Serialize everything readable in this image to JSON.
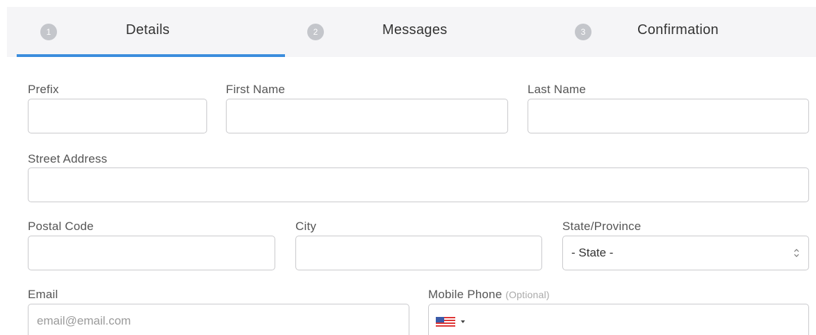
{
  "steps": [
    {
      "num": "1",
      "label": "Details",
      "active": true
    },
    {
      "num": "2",
      "label": "Messages",
      "active": false
    },
    {
      "num": "3",
      "label": "Confirmation",
      "active": false
    }
  ],
  "form": {
    "prefix_label": "Prefix",
    "first_name_label": "First Name",
    "last_name_label": "Last Name",
    "street_label": "Street Address",
    "postal_label": "Postal Code",
    "city_label": "City",
    "state_label": "State/Province",
    "state_value": "- State -",
    "email_label": "Email",
    "email_placeholder": "email@email.com",
    "phone_label": "Mobile Phone",
    "phone_optional": "(Optional)"
  },
  "colors": {
    "accent": "#3b8ddd",
    "step_badge": "#c4c6cb",
    "tab_background": "#f5f5f7"
  }
}
